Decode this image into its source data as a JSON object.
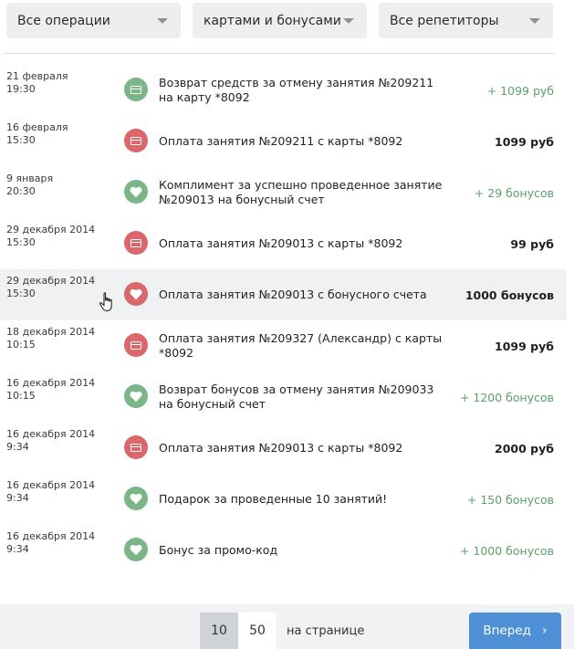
{
  "filters": {
    "operations": "Все операции",
    "payment_type": "картами и бонусами",
    "tutors": "Все репетиторы"
  },
  "transactions": [
    {
      "date": "21 февраля",
      "time": "19:30",
      "icon": "card-icon",
      "icon_color": "#7bb688",
      "description": "Возврат средств за отмену занятия №209211 на карту *8092",
      "amount": "+ 1099 руб",
      "positive": true
    },
    {
      "date": "16 февраля",
      "time": "15:30",
      "icon": "card-icon",
      "icon_color": "#d9676b",
      "description": "Оплата занятия №209211 с карты *8092",
      "amount": "1099 руб",
      "positive": false
    },
    {
      "date": "9 января",
      "time": "20:30",
      "icon": "heart-icon",
      "icon_color": "#7bb688",
      "description": "Комплимент за успешно проведенное занятие №209013 на бонусный счет",
      "amount": "+ 29 бонусов",
      "positive": true
    },
    {
      "date": "29 декабря 2014",
      "time": "15:30",
      "icon": "card-icon",
      "icon_color": "#d9676b",
      "description": "Оплата занятия №209013 с карты *8092",
      "amount": "99 руб",
      "positive": false
    },
    {
      "date": "29 декабря 2014",
      "time": "15:30",
      "icon": "heart-icon",
      "icon_color": "#d9676b",
      "description": "Оплата занятия №209013 с бонусного счета",
      "amount": "1000 бонусов",
      "positive": false
    },
    {
      "date": "18 декабря 2014",
      "time": "10:15",
      "icon": "card-icon",
      "icon_color": "#d9676b",
      "description": "Оплата занятия №209327 (Александр) с карты *8092",
      "amount": "1099 руб",
      "positive": false
    },
    {
      "date": "16 декабря 2014",
      "time": "10:15",
      "icon": "heart-icon",
      "icon_color": "#7bb688",
      "description": "Возврат бонусов за отмену занятия №209033 на бонусный счет",
      "amount": "+ 1200 бонусов",
      "positive": true
    },
    {
      "date": "16 декабря 2014",
      "time": "9:34",
      "icon": "card-icon",
      "icon_color": "#d9676b",
      "description": "Оплата занятия №209013 с карты *8092",
      "amount": "2000 руб",
      "positive": false
    },
    {
      "date": "16 декабря 2014",
      "time": "9:34",
      "icon": "heart-icon",
      "icon_color": "#7bb688",
      "description": "Подарок за проведенные 10 занятий!",
      "amount": "+ 150 бонусов",
      "positive": true
    },
    {
      "date": "16 декабря 2014",
      "time": "9:34",
      "icon": "heart-icon",
      "icon_color": "#7bb688",
      "description": "Бонус за промо-код",
      "amount": "+ 1000 бонусов",
      "positive": true
    }
  ],
  "pagination": {
    "option_10": "10",
    "option_50": "50",
    "per_page_label": "на странице",
    "next_label": "Вперед",
    "next_icon": "chevron-right-icon"
  }
}
